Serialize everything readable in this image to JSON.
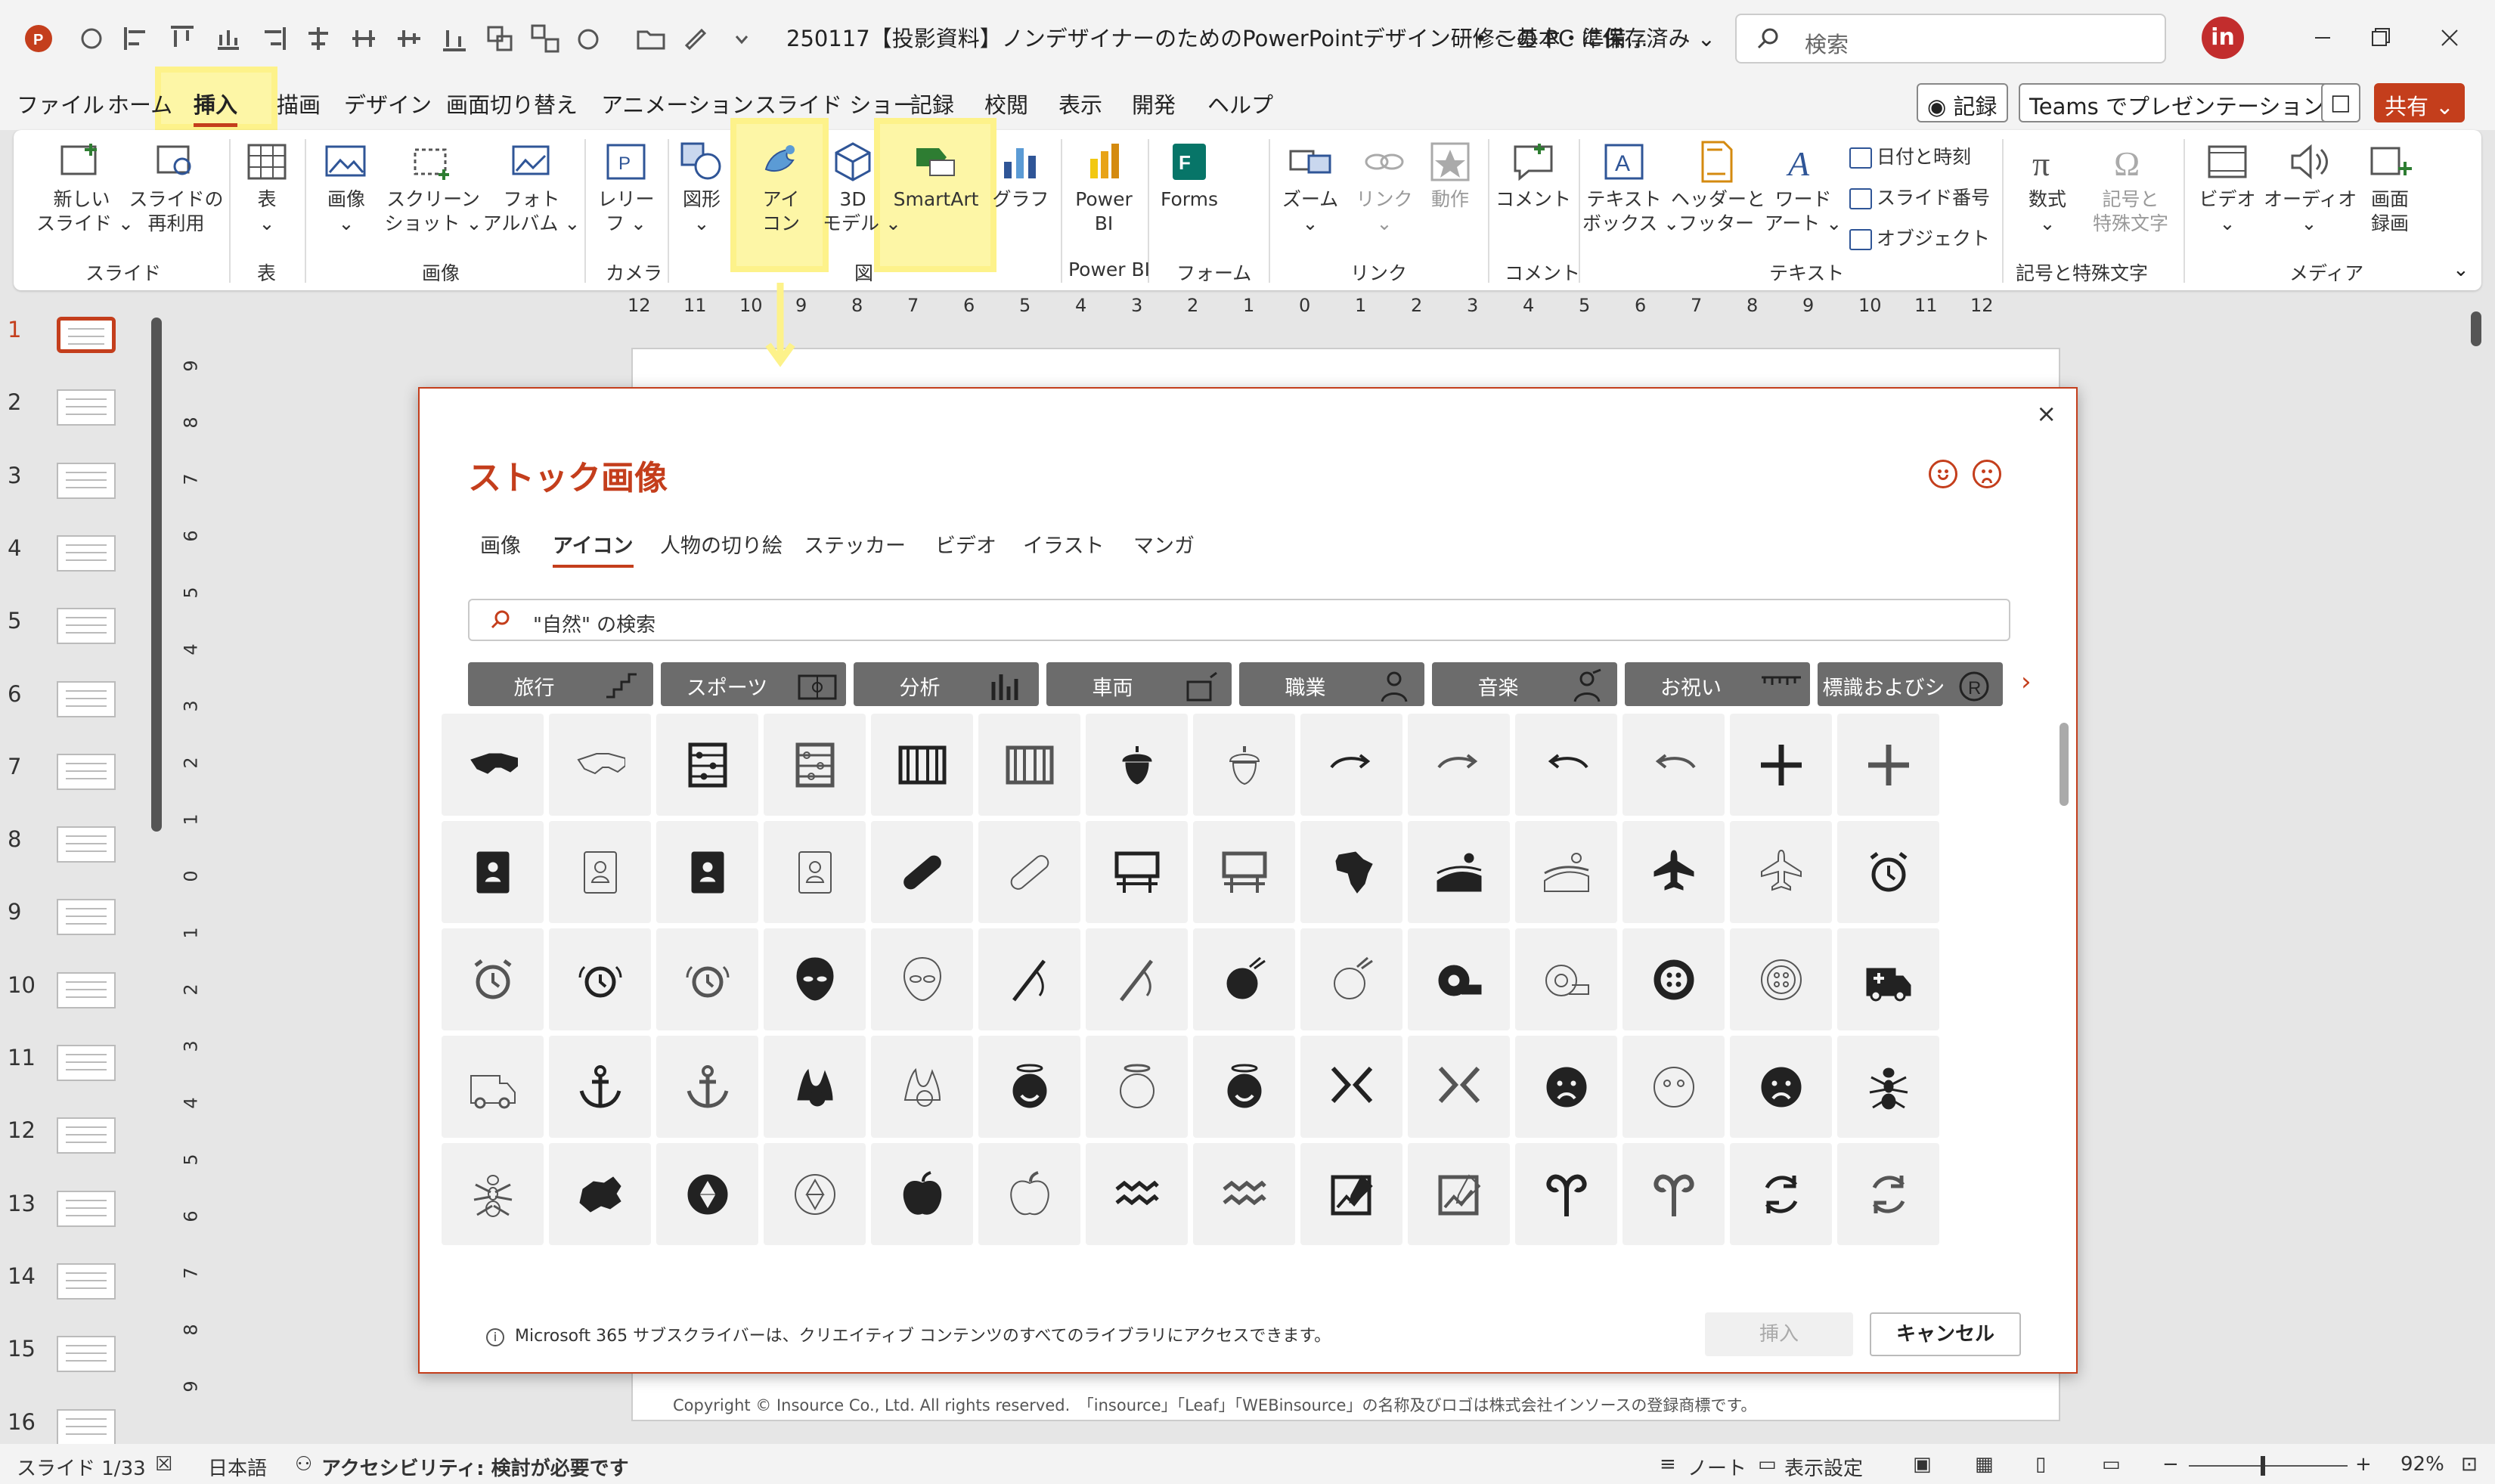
{
  "titlebar": {
    "doc_title": "250117【投影資料】ノンデザイナーのためのPowerPointデザイン研修～基本・準備…",
    "save_state": "• この PC に保存済み ⌄",
    "search_placeholder": "検索",
    "avatar_initials": "in"
  },
  "menu": {
    "tabs": [
      "ファイル",
      "ホーム",
      "挿入",
      "描画",
      "デザイン",
      "画面切り替え",
      "アニメーション",
      "スライド ショー",
      "記録",
      "校閲",
      "表示",
      "開発",
      "ヘルプ"
    ],
    "active_tab": "挿入",
    "record_button": "◉ 記録",
    "teams_button": "Teams でプレゼンテーション",
    "share_button": "共有 ⌄"
  },
  "ribbon": {
    "buttons": {
      "new_slide": "新しい\nスライド ⌄",
      "reuse_slide": "スライドの\n再利用",
      "table": "表\n⌄",
      "image": "画像\n⌄",
      "screenshot": "スクリーン\nショット ⌄",
      "photo_album": "フォト\nアルバム ⌄",
      "camera": "レリー\nフ ⌄",
      "shapes": "図形\n⌄",
      "icons": "アイ\nコン",
      "model3d": "3D\nモデル ⌄",
      "smartart": "SmartArt",
      "chart": "グラフ",
      "powerbi": "Power\nBI",
      "forms": "Forms",
      "zoom": "ズーム\n⌄",
      "link": "リンク\n⌄",
      "action": "動作",
      "comment": "コメント",
      "textbox": "テキスト\nボックス ⌄",
      "header_footer": "ヘッダーと\nフッター",
      "wordart": "ワード\nアート ⌄",
      "equation": "数式\n⌄",
      "symbol": "記号と\n特殊文字",
      "video": "ビデオ\n⌄",
      "audio": "オーディオ\n⌄",
      "screen_recording": "画面\n録画"
    },
    "small_buttons": {
      "datetime": "日付と時刻",
      "slide_number": "スライド番号",
      "object": "オブジェクト"
    },
    "groups": [
      "スライド",
      "表",
      "画像",
      "カメラ",
      "図",
      "Power BI",
      "フォーム",
      "リンク",
      "コメント",
      "テキスト",
      "記号と特殊文字",
      "メディア"
    ]
  },
  "thumbnails": [
    "1",
    "2",
    "3",
    "4",
    "5",
    "6",
    "7",
    "8",
    "9",
    "10",
    "11",
    "12",
    "13",
    "14",
    "15",
    "16"
  ],
  "hruler": [
    "12",
    "11",
    "10",
    "9",
    "8",
    "7",
    "6",
    "5",
    "4",
    "3",
    "2",
    "1",
    "0",
    "1",
    "2",
    "3",
    "4",
    "5",
    "6",
    "7",
    "8",
    "9",
    "10",
    "11",
    "12"
  ],
  "vruler": [
    "9",
    "8",
    "7",
    "6",
    "5",
    "4",
    "3",
    "2",
    "1",
    "0",
    "1",
    "2",
    "3",
    "4",
    "5",
    "6",
    "7",
    "8",
    "9"
  ],
  "slide": {
    "footer": "Copyright © Insource Co., Ltd. All rights reserved.　「insource」「Leaf」「WEBinsource」の名称及びロゴは株式会社インソースの登録商標です。"
  },
  "dialog": {
    "title": "ストック画像",
    "close": "×",
    "tabs": [
      "画像",
      "アイコン",
      "人物の切り絵",
      "ステッカー",
      "ビデオ",
      "イラスト",
      "マンガ"
    ],
    "active_tab": "アイコン",
    "search_value": "\"自然\" の検索",
    "categories": [
      "旅行",
      "スポーツ",
      "分析",
      "車両",
      "職業",
      "音楽",
      "お祝い",
      "標識およびシ"
    ],
    "icons": [
      [
        "glasses-3d-icon",
        "glasses-3d-outline-icon",
        "abacus-icon",
        "abacus-outline-icon",
        "abacus-wide-icon",
        "abacus-wide-outline-icon",
        "acorn-icon",
        "acorn-outline-icon",
        "arrow-right-icon",
        "arrow-right-outline-icon",
        "arrow-left-icon",
        "arrow-left-outline-icon",
        "plus-icon",
        "plus-outline-icon"
      ],
      [
        "address-book-icon",
        "address-book-outline-icon",
        "address-book-icon",
        "address-book-outline-icon",
        "bandage-icon",
        "bandage-outline-icon",
        "billboard-icon",
        "billboard-outline-icon",
        "africa-icon",
        "field-icon",
        "field-outline-icon",
        "airplane-icon",
        "airplane-outline-icon",
        "alarm-clock-icon"
      ],
      [
        "alarm-clock-outline-icon",
        "alarm-ringing-icon",
        "alarm-ringing-outline-icon",
        "alien-icon",
        "alien-outline-icon",
        "needle-icon",
        "needle-outline-icon",
        "yarn-icon",
        "yarn-outline-icon",
        "tape-measure-icon",
        "tape-measure-outline-icon",
        "button-icon",
        "button-outline-icon",
        "ambulance-icon"
      ],
      [
        "ambulance-outline-icon",
        "anchor-icon",
        "anchor-outline-icon",
        "anemone-icon",
        "anemone-outline-icon",
        "angel-face-icon",
        "angel-face-outline-icon",
        "angel-face-icon",
        "angry-face-icon",
        "angry-face-outline-icon",
        "frown-face-icon",
        "frown-face-outline-icon",
        "frown-face-icon",
        "ant-icon"
      ],
      [
        "ant-outline-icon",
        "antarctica-icon",
        "aperture-icon",
        "aperture-outline-icon",
        "apple-icon",
        "apple-outline-icon",
        "aquarius-icon",
        "aquarius-outline-icon",
        "sketch-icon",
        "sketch-outline-icon",
        "aries-icon",
        "aries-outline-icon",
        "refresh-icon",
        "refresh-outline-icon"
      ]
    ],
    "info_text": "Microsoft 365 サブスクライバーは、クリエイティブ コンテンツのすべてのライブラリにアクセスできます。",
    "insert_button": "挿入",
    "cancel_button": "キャンセル"
  },
  "statusbar": {
    "slide_count": "スライド 1/33",
    "language": "日本語",
    "accessibility": "アクセシビリティ: 検討が必要です",
    "notes": "ノート",
    "display_settings": "表示設定",
    "zoom_minus": "−",
    "zoom_plus": "+",
    "zoom_level": "92%"
  },
  "colors": {
    "accent": "#c43e1c",
    "highlight": "#fdf28a"
  }
}
